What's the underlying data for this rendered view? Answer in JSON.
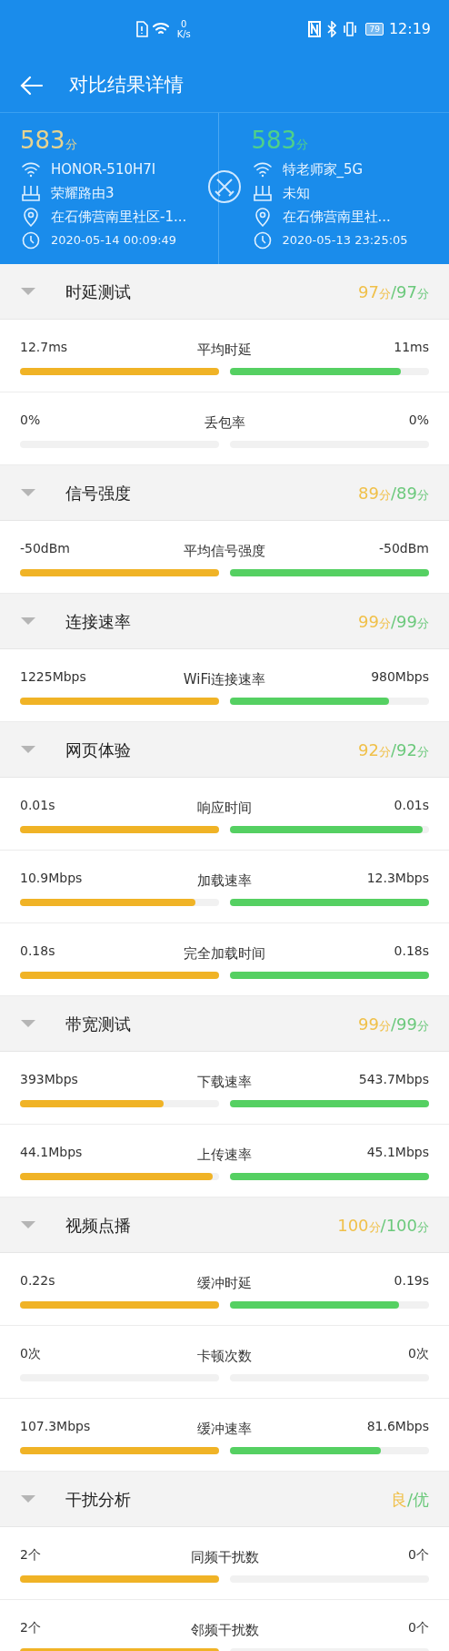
{
  "status_bar": {
    "speed_value": "0",
    "speed_unit": "K/s",
    "battery": "79",
    "time": "12:19"
  },
  "title_bar": {
    "title": "对比结果详情"
  },
  "networks": [
    {
      "score": "583",
      "score_unit": "分",
      "ssid": "HONOR-510H7I",
      "router": "荣耀路由3",
      "location": "在石佛营南里社区-1...",
      "time": "2020-05-14 00:09:49",
      "color": "#e6d38f"
    },
    {
      "score": "583",
      "score_unit": "分",
      "ssid": "特老师家_5G",
      "router": "未知",
      "location": "在石佛营南里社...",
      "time": "2020-05-13 23:25:05",
      "color": "#4fd08a"
    }
  ],
  "sections": [
    {
      "title": "时延测试",
      "expanded": true,
      "score_left": {
        "value": "97",
        "unit": "分"
      },
      "separator": "/",
      "score_right": {
        "value": "97",
        "unit": "分"
      },
      "metrics": [
        {
          "name": "平均时延",
          "left": {
            "value": "12.7ms",
            "level": 1.0
          },
          "right": {
            "value": "11ms",
            "level": 0.86
          }
        },
        {
          "name": "丢包率",
          "left": {
            "value": "0%"
          },
          "right": {
            "value": "0%"
          }
        }
      ]
    },
    {
      "title": "信号强度",
      "expanded": true,
      "score_left": {
        "value": "89",
        "unit": "分"
      },
      "separator": "/",
      "score_right": {
        "value": "89",
        "unit": "分"
      },
      "metrics": [
        {
          "name": "平均信号强度",
          "left": {
            "value": "-50dBm",
            "level": 1.0
          },
          "right": {
            "value": "-50dBm",
            "level": 1.0
          }
        }
      ]
    },
    {
      "title": "连接速率",
      "expanded": true,
      "score_left": {
        "value": "99",
        "unit": "分"
      },
      "separator": "/",
      "score_right": {
        "value": "99",
        "unit": "分"
      },
      "metrics": [
        {
          "name": "WiFi连接速率",
          "left": {
            "value": "1225Mbps",
            "level": 1.0
          },
          "right": {
            "value": "980Mbps",
            "level": 0.8
          }
        }
      ]
    },
    {
      "title": "网页体验",
      "expanded": true,
      "score_left": {
        "value": "92",
        "unit": "分"
      },
      "separator": "/",
      "score_right": {
        "value": "92",
        "unit": "分"
      },
      "metrics": [
        {
          "name": "响应时间",
          "left": {
            "value": "0.01s",
            "level": 1.0
          },
          "right": {
            "value": "0.01s",
            "level": 0.97
          }
        },
        {
          "name": "加载速率",
          "left": {
            "value": "10.9Mbps",
            "level": 0.88
          },
          "right": {
            "value": "12.3Mbps",
            "level": 1.0
          }
        },
        {
          "name": "完全加载时间",
          "left": {
            "value": "0.18s",
            "level": 1.0
          },
          "right": {
            "value": "0.18s",
            "level": 1.0
          }
        }
      ]
    },
    {
      "title": "带宽测试",
      "expanded": true,
      "score_left": {
        "value": "99",
        "unit": "分"
      },
      "separator": "/",
      "score_right": {
        "value": "99",
        "unit": "分"
      },
      "metrics": [
        {
          "name": "下载速率",
          "left": {
            "value": "393Mbps",
            "level": 0.72
          },
          "right": {
            "value": "543.7Mbps",
            "level": 1.0
          }
        },
        {
          "name": "上传速率",
          "left": {
            "value": "44.1Mbps",
            "level": 0.97
          },
          "right": {
            "value": "45.1Mbps",
            "level": 1.0
          }
        }
      ]
    },
    {
      "title": "视频点播",
      "expanded": true,
      "score_left": {
        "value": "100",
        "unit": "分"
      },
      "separator": "/",
      "score_right": {
        "value": "100",
        "unit": "分"
      },
      "metrics": [
        {
          "name": "缓冲时延",
          "left": {
            "value": "0.22s",
            "level": 1.0
          },
          "right": {
            "value": "0.19s",
            "level": 0.85
          }
        },
        {
          "name": "卡顿次数",
          "left": {
            "value": "0次"
          },
          "right": {
            "value": "0次"
          }
        },
        {
          "name": "缓冲速率",
          "left": {
            "value": "107.3Mbps",
            "level": 1.0
          },
          "right": {
            "value": "81.6Mbps",
            "level": 0.76
          }
        }
      ]
    },
    {
      "title": "干扰分析",
      "expanded": true,
      "score_left": {
        "value": "良"
      },
      "separator": "/",
      "score_right": {
        "value": "优"
      },
      "metrics": [
        {
          "name": "同频干扰数",
          "left": {
            "value": "2个",
            "level": 1.0
          },
          "right": {
            "value": "0个"
          }
        },
        {
          "name": "邻频干扰数",
          "left": {
            "value": "2个",
            "level": 1.0
          },
          "right": {
            "value": "0个"
          }
        }
      ]
    }
  ]
}
